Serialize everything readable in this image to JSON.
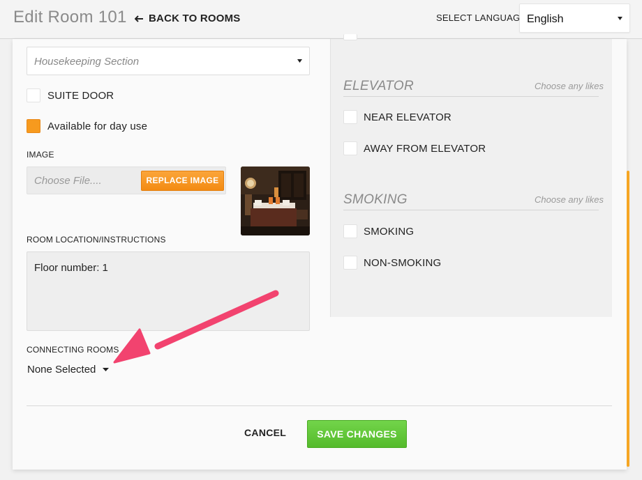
{
  "header": {
    "title": "Edit Room 101",
    "back_label": "BACK TO ROOMS",
    "language_label": "SELECT LANGUAGE",
    "language_value": "English"
  },
  "form": {
    "housekeeping_placeholder": "Housekeeping Section",
    "suite_door_label": "SUITE DOOR",
    "suite_door_checked": false,
    "day_use_label": "Available for day use",
    "day_use_checked": true,
    "image_label": "IMAGE",
    "file_placeholder": "Choose File....",
    "replace_image_label": "REPLACE IMAGE",
    "location_label": "ROOM LOCATION/INSTRUCTIONS",
    "location_value": "Floor number: 1",
    "connecting_label": "CONNECTING ROOMS",
    "connecting_value": "None Selected"
  },
  "preferences": {
    "elevator": {
      "title": "ELEVATOR",
      "hint": "Choose any likes",
      "options": [
        "NEAR ELEVATOR",
        "AWAY FROM ELEVATOR"
      ]
    },
    "smoking": {
      "title": "SMOKING",
      "hint": "Choose any likes",
      "options": [
        "SMOKING",
        "NON-SMOKING"
      ]
    }
  },
  "footer": {
    "cancel_label": "CANCEL",
    "save_label": "SAVE CHANGES"
  },
  "colors": {
    "accent_orange": "#f79a1e",
    "save_green": "#5cc236",
    "annotation_pink": "#f2436f"
  },
  "icons": {
    "back": "arrow-left-icon",
    "dropdown": "caret-down-icon"
  }
}
